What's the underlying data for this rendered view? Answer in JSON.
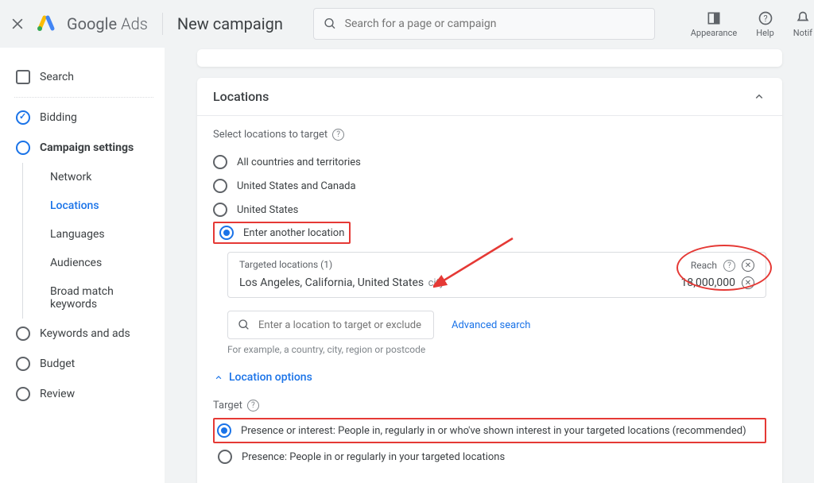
{
  "header": {
    "brand_regular": "Google",
    "brand_light": "Ads",
    "page_title": "New campaign",
    "search_placeholder": "Search for a page or campaign",
    "icons": {
      "appearance": "Appearance",
      "help": "Help",
      "notif": "Notif"
    }
  },
  "sidebar": {
    "search": "Search",
    "bidding": "Bidding",
    "campaign_settings": "Campaign settings",
    "sub_items": [
      "Network",
      "Locations",
      "Languages",
      "Audiences",
      "Broad match keywords"
    ],
    "keywords": "Keywords and ads",
    "budget": "Budget",
    "review": "Review"
  },
  "locations": {
    "section_title": "Locations",
    "select_label": "Select locations to target",
    "options": [
      "All countries and territories",
      "United States and Canada",
      "United States",
      "Enter another location"
    ],
    "targeted_header": "Targeted locations (1)",
    "reach_header": "Reach",
    "targeted_name": "Los Angeles, California, United States",
    "targeted_type": "city",
    "reach_value": "18,000,000",
    "search_placeholder": "Enter a location to target or exclude",
    "advanced": "Advanced search",
    "example": "For example, a country, city, region or postcode",
    "loc_options": "Location options",
    "target_label": "Target",
    "target_options": [
      "Presence or interest: People in, regularly in or who've shown interest in your targeted locations (recommended)",
      "Presence: People in or regularly in your targeted locations"
    ]
  }
}
